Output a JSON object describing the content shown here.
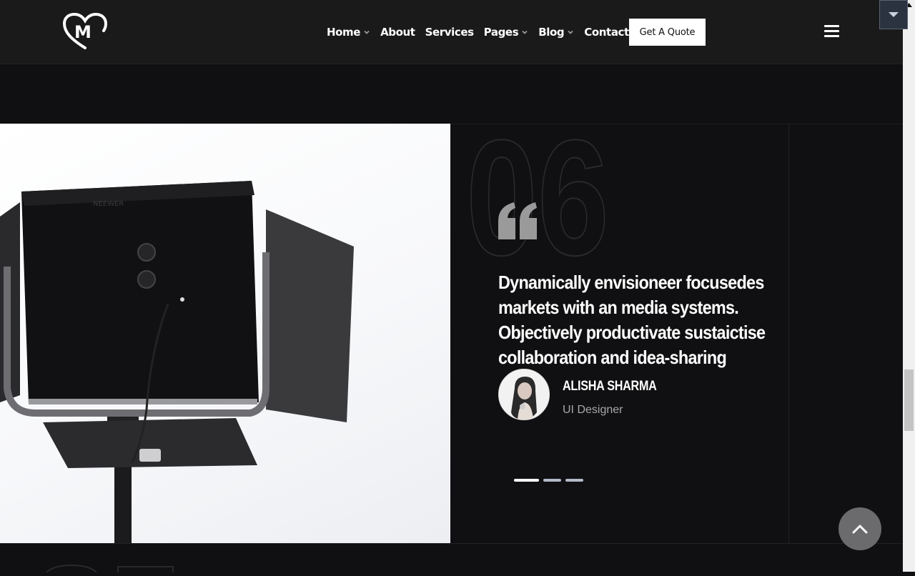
{
  "brand": {
    "logo_letter": "M"
  },
  "nav": {
    "items": [
      {
        "label": "Home",
        "has_dropdown": true
      },
      {
        "label": "About",
        "has_dropdown": false
      },
      {
        "label": "Services",
        "has_dropdown": false
      },
      {
        "label": "Pages",
        "has_dropdown": true
      },
      {
        "label": "Blog",
        "has_dropdown": true
      },
      {
        "label": "Contact",
        "has_dropdown": false
      }
    ],
    "cta_label": "Get A Quote",
    "menu_icon": "hamburger-icon"
  },
  "testimonial": {
    "number": "06",
    "quote": "Dynamically envisioneer focusedes markets with an media systems. Objectively productivate sustaictise collaboration and idea-sharing",
    "author_name": "ALISHA SHARMA",
    "author_role": "UI Designer",
    "slider_dots": 3,
    "active_dot": 0
  },
  "colors": {
    "background": "#101012",
    "header": "#1a1a1b",
    "dot_inactive": "#b4bacb",
    "quote_mark": "#9a9a9a",
    "scroll_top": "#6b6b6d"
  }
}
